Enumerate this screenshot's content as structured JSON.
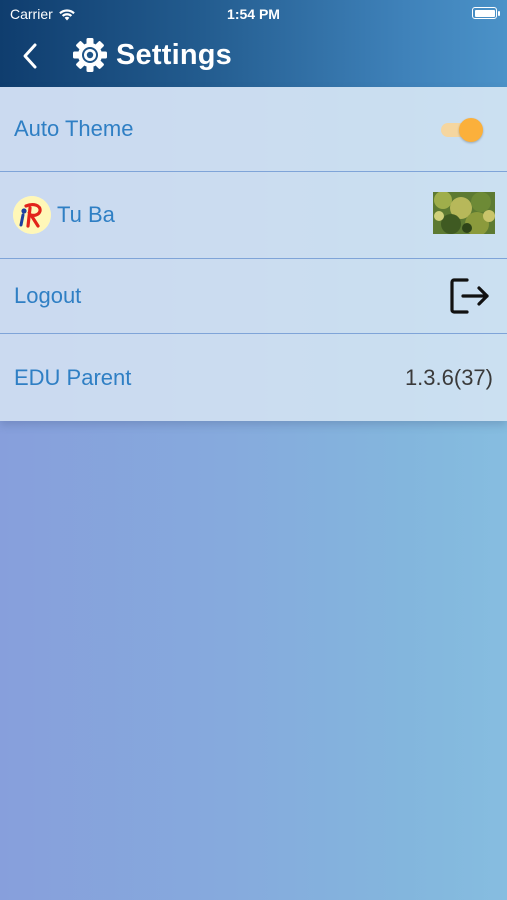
{
  "status_bar": {
    "carrier": "Carrier",
    "time": "1:54 PM",
    "wifi_icon": "wifi-icon",
    "battery_icon": "battery-icon"
  },
  "header": {
    "title": "Settings",
    "back_icon": "chevron-left-icon",
    "title_icon": "gear-icon"
  },
  "settings": {
    "auto_theme": {
      "label": "Auto Theme",
      "enabled": true
    },
    "user": {
      "name": "Tu Ba",
      "avatar_icon": "app-logo-avatar",
      "thumbnail": "user-photo-thumbnail"
    },
    "logout": {
      "label": "Logout",
      "icon": "logout-icon"
    },
    "app": {
      "label": "EDU Parent",
      "version": "1.3.6(37)"
    }
  },
  "colors": {
    "header_start": "#0f3d6e",
    "header_end": "#4b92c8",
    "label_blue": "#2f7fc4",
    "toggle_on": "#fbb03b",
    "background_start": "#879fdc",
    "background_end": "#86bde0"
  }
}
